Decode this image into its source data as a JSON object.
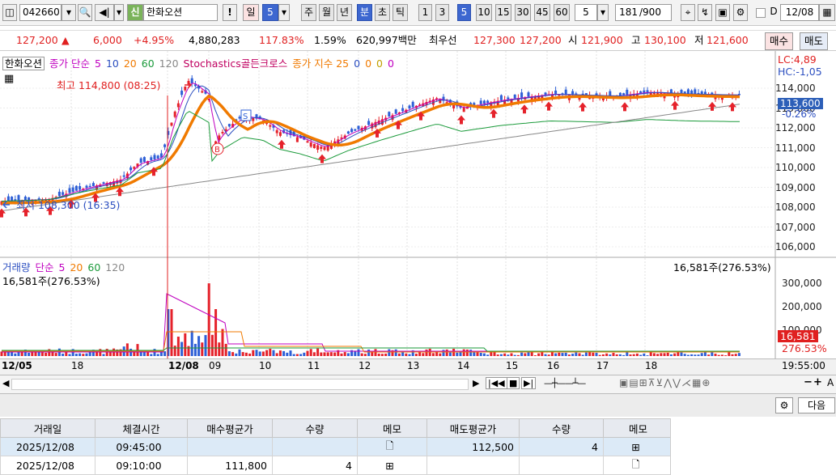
{
  "toolbar": {
    "code": "042660",
    "badge": "신",
    "name": "한화오션",
    "excl": "!",
    "day": "일",
    "five": "5",
    "periods": [
      "주",
      "월",
      "년",
      "분",
      "초",
      "틱"
    ],
    "mins": [
      "1",
      "3",
      "5",
      "10",
      "15",
      "30",
      "45",
      "60"
    ],
    "interval": "5",
    "count": "181",
    "countmax": "/900",
    "date": "12/08",
    "date2_label": "D"
  },
  "quote": {
    "price": "127,200",
    "change": "6,000",
    "pct": "+4.95%",
    "volume": "4,880,283",
    "vol_ratio": "117.83%",
    "turnover_rate": "1.59%",
    "amount": "620,997백만",
    "best_ask_label": "최우선",
    "best_ask": "127,300",
    "best_bid": "127,200",
    "open_label": "시",
    "open": "121,900",
    "high_label": "고",
    "high": "130,100",
    "low_label": "저",
    "low": "121,600",
    "buy": "매수",
    "sell": "매도"
  },
  "price_panel": {
    "stock_label": "한화오션",
    "ma_label": "종가 단순",
    "ma": [
      "5",
      "10",
      "20",
      "60",
      "120"
    ],
    "stoch_label": "Stochastics골든크로스",
    "ema_label": "종가 지수 25",
    "ema_vals": [
      "0",
      "0",
      "0",
      "0"
    ],
    "lc": "LC:4,89",
    "hc": "HC:-1,05",
    "high_note": "최고 114,800 (08:25)",
    "low_note": "최저 108,300 (16:35)",
    "last_price": "113,600",
    "last_pct": "-0.26%",
    "yticks": [
      "114,000",
      "113,000",
      "112,000",
      "111,000",
      "110,000",
      "109,000",
      "108,000",
      "107,000",
      "106,000"
    ],
    "signal_b": "B",
    "signal_s": "S"
  },
  "volume_panel": {
    "label": "거래량",
    "ma_label": "단순",
    "ma": [
      "5",
      "20",
      "60",
      "120"
    ],
    "sub": "16,581주(276.53%)",
    "right_note": "16,581주(276.53%)",
    "yticks": [
      "300,000",
      "200,000",
      "100,000"
    ],
    "last_vol": "16,581",
    "last_pct": "276.53%"
  },
  "xaxis": {
    "labels": [
      "12/05",
      "18",
      "12/08",
      "09",
      "10",
      "11",
      "12",
      "13",
      "14",
      "15",
      "16",
      "17",
      "18"
    ],
    "time": "19:55:00"
  },
  "bottom": {
    "next": "다음"
  },
  "table": {
    "headers": [
      "거래일",
      "체결시간",
      "매수평균가",
      "수량",
      "메모",
      "매도평균가",
      "수량",
      "메모"
    ],
    "rows": [
      [
        "2025/12/08",
        "09:45:00",
        "",
        "",
        "",
        "112,500",
        "4",
        ""
      ],
      [
        "2025/12/08",
        "09:10:00",
        "111,800",
        "4",
        "",
        "",
        "",
        ""
      ]
    ]
  },
  "colors": {
    "up": "#e5222b",
    "down": "#2e5fd6",
    "ma5": "#c000c0",
    "ma10": "#2c4fc0",
    "ma20": "#f07a00",
    "ma60": "#1a9a3a",
    "ma120": "#888888"
  }
}
